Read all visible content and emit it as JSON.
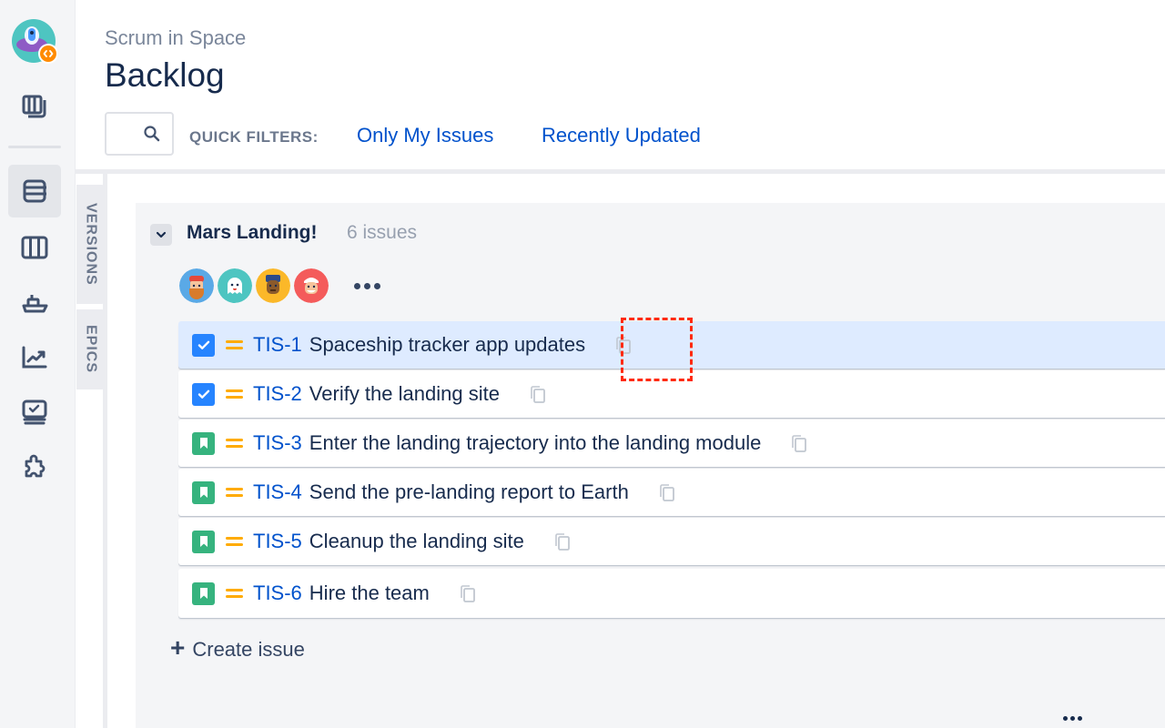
{
  "nav": {
    "logo_icon": "rocket-project-logo",
    "items": [
      {
        "name": "releases",
        "icon": "releases-icon",
        "active": false
      },
      {
        "name": "backlog",
        "icon": "backlog-icon",
        "active": true
      },
      {
        "name": "board",
        "icon": "board-icon",
        "active": false
      },
      {
        "name": "releases-ship",
        "icon": "ship-icon",
        "active": false
      },
      {
        "name": "reports",
        "icon": "reports-icon",
        "active": false
      },
      {
        "name": "issues",
        "icon": "issues-icon",
        "active": false
      },
      {
        "name": "add-ons",
        "icon": "puzzle-icon",
        "active": false
      }
    ]
  },
  "header": {
    "project_name": "Scrum in Space",
    "title": "Backlog",
    "search": {
      "value": "",
      "placeholder": ""
    },
    "quick_filters_label": "QUICK FILTERS:",
    "quick_filters": [
      "Only My Issues",
      "Recently Updated"
    ]
  },
  "side_tabs": [
    "VERSIONS",
    "EPICS"
  ],
  "sprint": {
    "name": "Mars Landing!",
    "count_label": "6 issues",
    "assignees": [
      {
        "name": "assignee-1",
        "color": "#5aa9e6"
      },
      {
        "name": "assignee-2",
        "color": "#4ec5c1"
      },
      {
        "name": "assignee-3",
        "color": "#fbb829"
      },
      {
        "name": "assignee-4",
        "color": "#f45b5b"
      }
    ],
    "issues": [
      {
        "type": "task",
        "priority": "medium",
        "key": "TIS-1",
        "summary": "Spaceship tracker app updates",
        "selected": true
      },
      {
        "type": "task",
        "priority": "medium",
        "key": "TIS-2",
        "summary": "Verify the landing site",
        "selected": false
      },
      {
        "type": "story",
        "priority": "medium",
        "key": "TIS-3",
        "summary": "Enter the landing trajectory into the landing module",
        "selected": false
      },
      {
        "type": "story",
        "priority": "medium",
        "key": "TIS-4",
        "summary": "Send the pre-landing report to Earth",
        "selected": false
      },
      {
        "type": "story",
        "priority": "medium",
        "key": "TIS-5",
        "summary": "Cleanup the landing site",
        "selected": false
      },
      {
        "type": "story",
        "priority": "medium",
        "key": "TIS-6",
        "summary": "Hire the team",
        "selected": false
      }
    ],
    "create_issue_label": "Create issue"
  },
  "colors": {
    "accent": "#0052cc",
    "task": "#2684ff",
    "story": "#36b37e",
    "priority_medium": "#ffab00",
    "selected_row": "#deebff",
    "highlight": "#ff2a0f"
  }
}
